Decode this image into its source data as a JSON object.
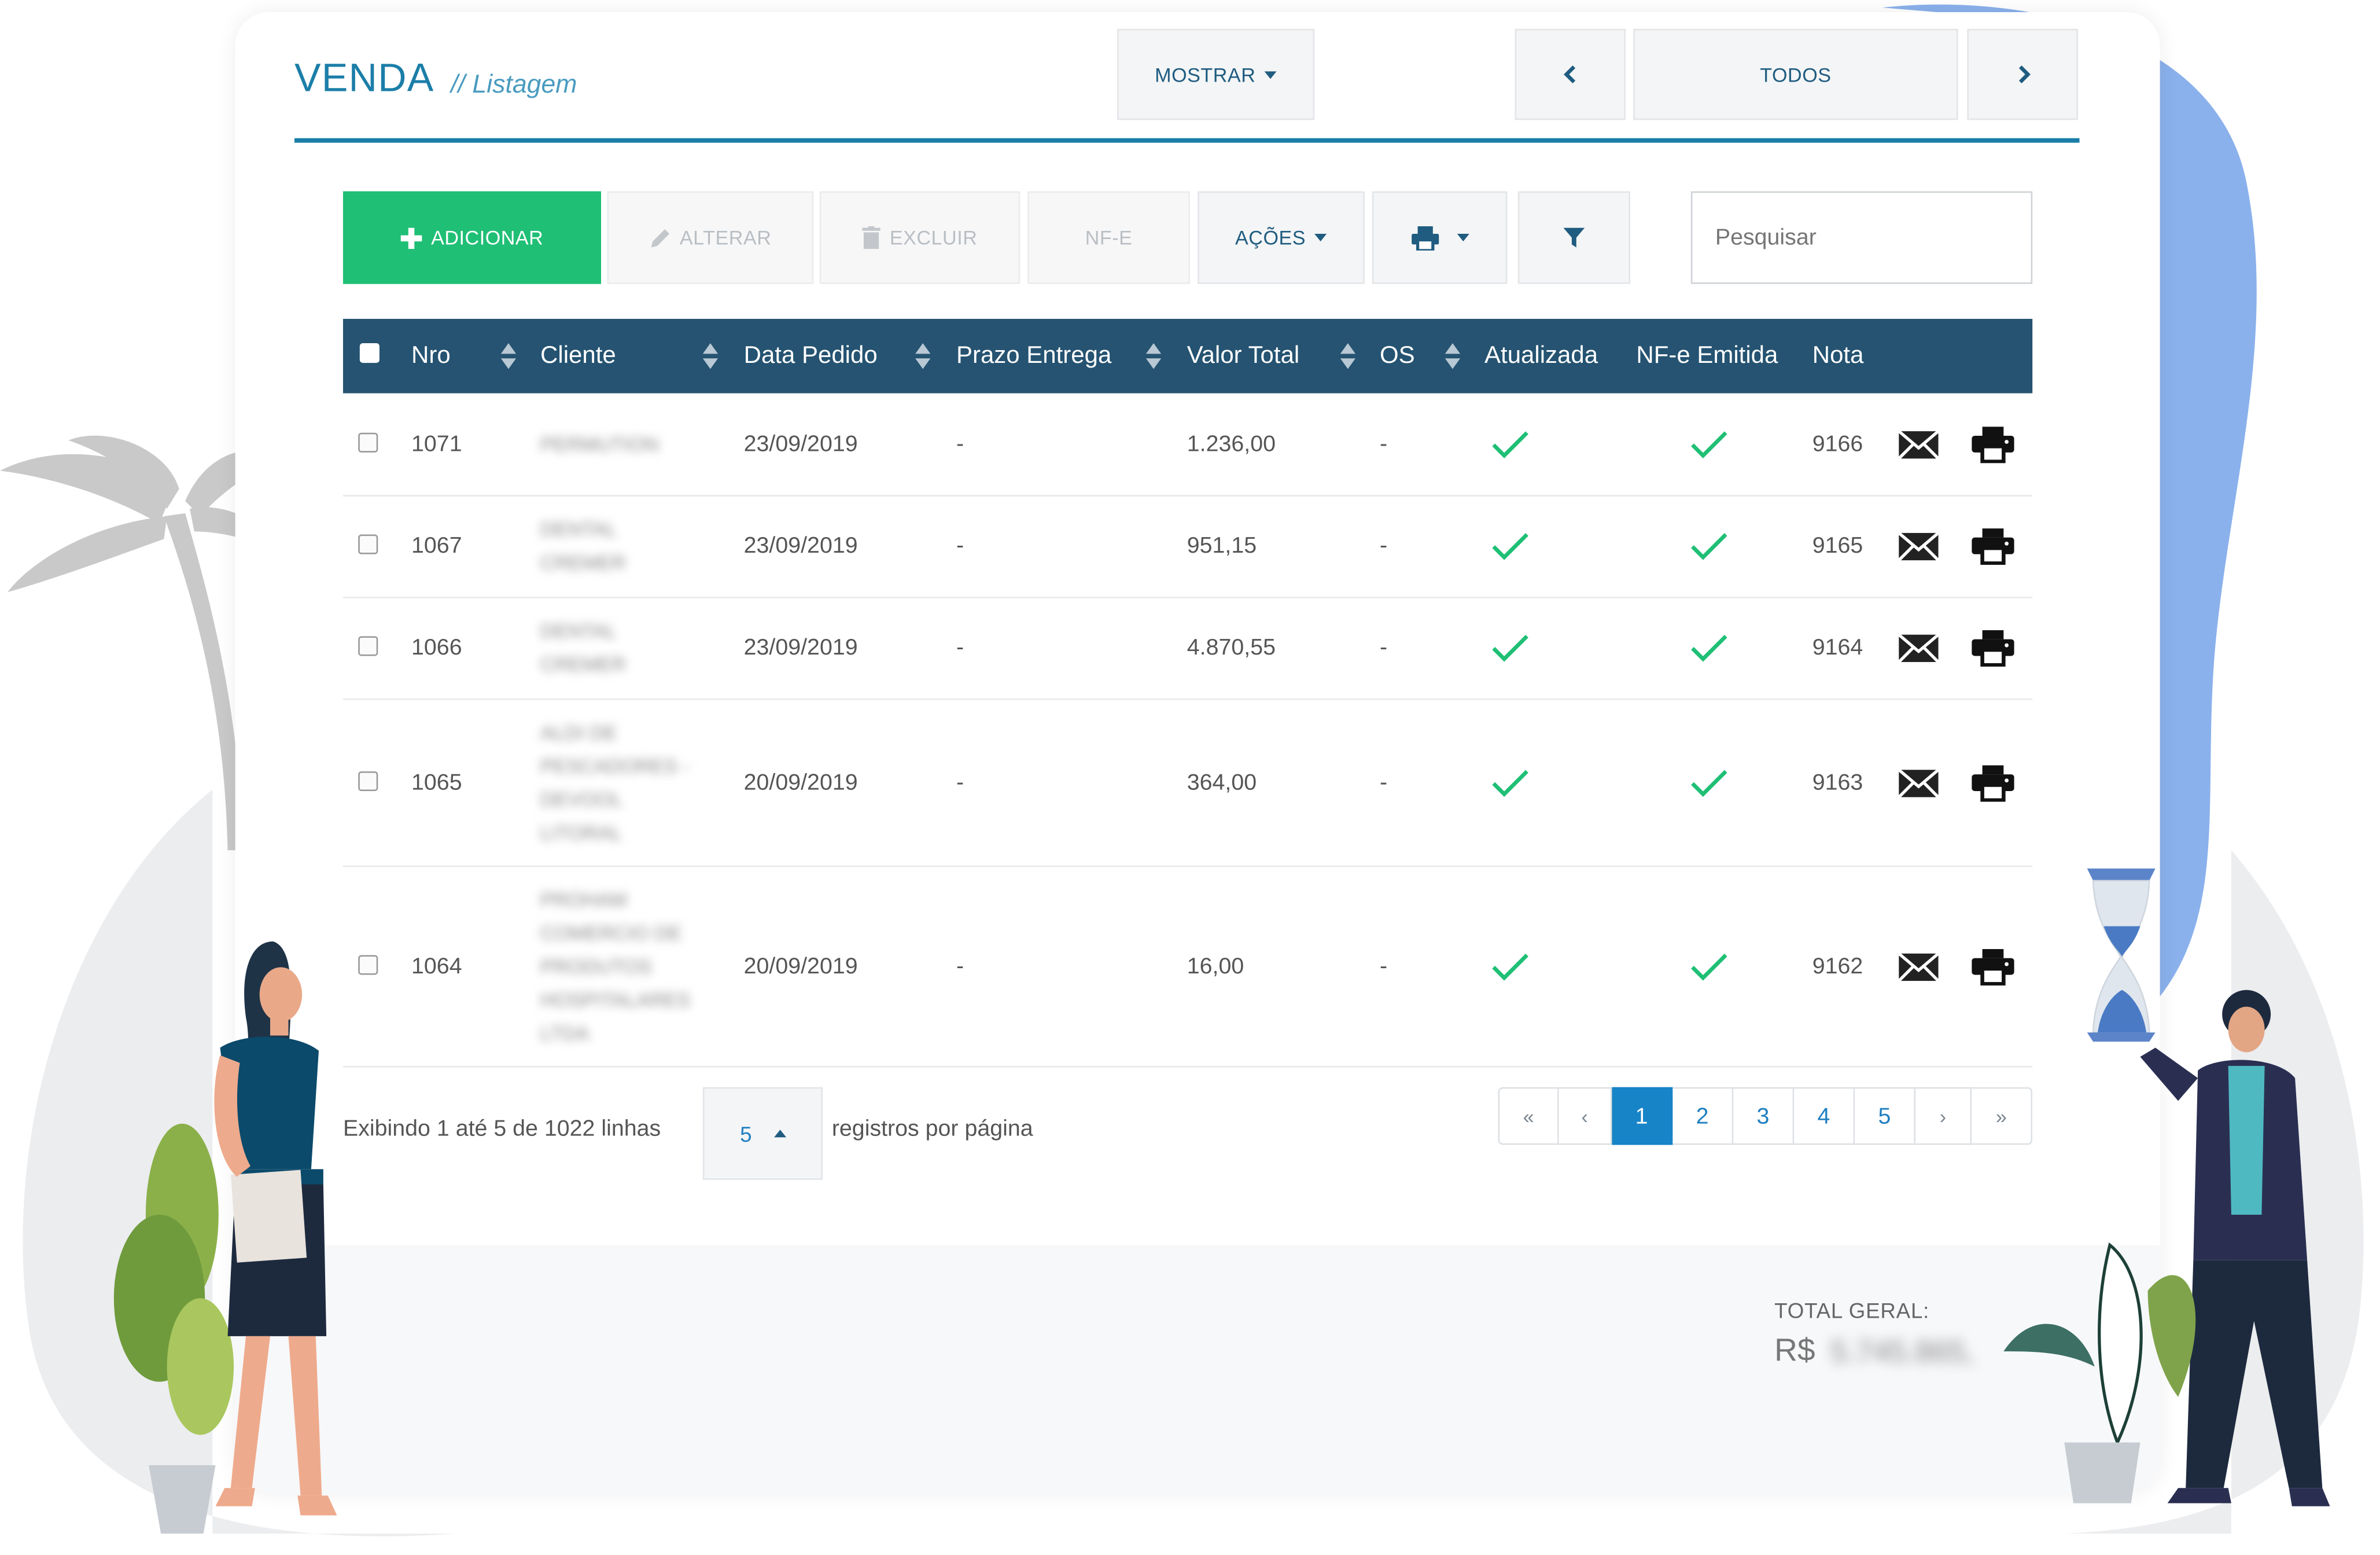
{
  "header": {
    "title": "VENDA",
    "subtitle": "// Listagem",
    "show_label": "MOSTRAR",
    "period_label": "TODOS"
  },
  "toolbar": {
    "add_label": "ADICIONAR",
    "edit_label": "ALTERAR",
    "delete_label": "EXCLUIR",
    "nfe_label": "NF-E",
    "actions_label": "AÇÕES",
    "search_placeholder": "Pesquisar"
  },
  "table": {
    "columns": [
      "Nro",
      "Cliente",
      "Data Pedido",
      "Prazo Entrega",
      "Valor Total",
      "OS",
      "Atualizada",
      "NF-e Emitida",
      "Nota"
    ],
    "rows": [
      {
        "nro": "1071",
        "cliente": [
          "PERMUTION"
        ],
        "data": "23/09/2019",
        "prazo": "-",
        "valor": "1.236,00",
        "os": "-",
        "nota": "9166"
      },
      {
        "nro": "1067",
        "cliente": [
          "DENTAL",
          "CREMER"
        ],
        "data": "23/09/2019",
        "prazo": "-",
        "valor": "951,15",
        "os": "-",
        "nota": "9165"
      },
      {
        "nro": "1066",
        "cliente": [
          "DENTAL",
          "CREMER"
        ],
        "data": "23/09/2019",
        "prazo": "-",
        "valor": "4.870,55",
        "os": "-",
        "nota": "9164"
      },
      {
        "nro": "1065",
        "cliente": [
          "ALDI DE",
          "PESCADORES -",
          "DEVOOL",
          "LITORAL"
        ],
        "data": "20/09/2019",
        "prazo": "-",
        "valor": "364,00",
        "os": "-",
        "nota": "9163"
      },
      {
        "nro": "1064",
        "cliente": [
          "PROHAM",
          "COMERCIO DE",
          "PRODUTOS",
          "HOSPITALARES",
          "LTDA"
        ],
        "data": "20/09/2019",
        "prazo": "-",
        "valor": "16,00",
        "os": "-",
        "nota": "9162"
      }
    ]
  },
  "footer": {
    "showing": "Exibindo 1 até 5 de 1022 linhas",
    "page_size": "5",
    "per_page": "registros por página",
    "pages": [
      "«",
      "‹",
      "1",
      "2",
      "3",
      "4",
      "5",
      "›",
      "»"
    ],
    "current_page": "1"
  },
  "total": {
    "label": "TOTAL GERAL:",
    "currency": "R$",
    "value": "5.745.865,"
  },
  "colors": {
    "accent": "#1b7ea8",
    "header_bg": "#255371",
    "add_button": "#1fbf75",
    "check": "#1fbf75",
    "pagination_active": "#1784c7"
  }
}
